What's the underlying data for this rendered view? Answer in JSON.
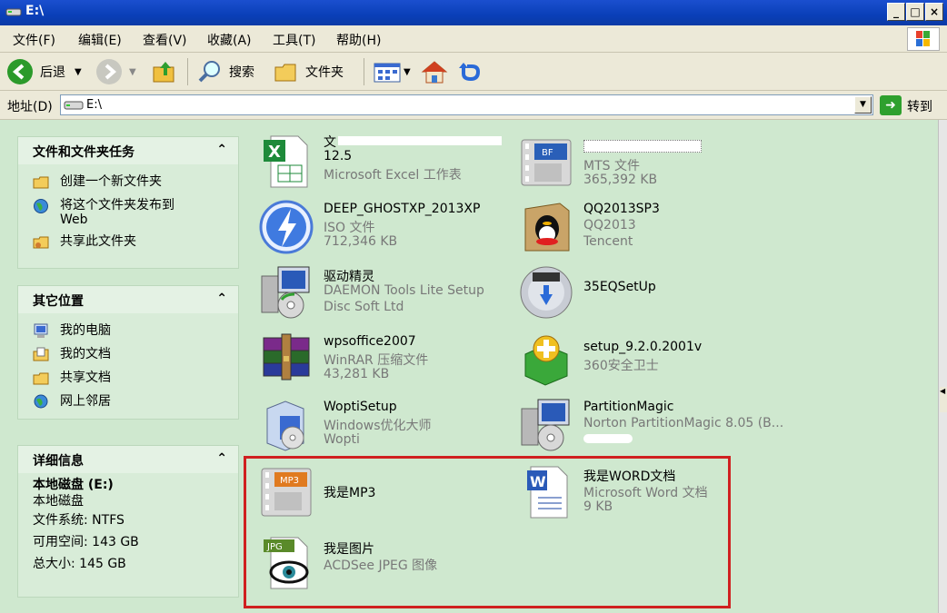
{
  "window": {
    "title": "E:\\"
  },
  "menu": [
    "文件(F)",
    "编辑(E)",
    "查看(V)",
    "收藏(A)",
    "工具(T)",
    "帮助(H)"
  ],
  "toolbar": {
    "back_label": "后退",
    "search_label": "搜索",
    "folders_label": "文件夹"
  },
  "address": {
    "label": "地址(D)",
    "value": "E:\\",
    "go_label": "转到"
  },
  "left_pane": {
    "tasks": {
      "title": "文件和文件夹任务",
      "items": [
        {
          "label": "创建一个新文件夹",
          "icon": "new-folder-icon"
        },
        {
          "label": "将这个文件夹发布到",
          "label2": "Web",
          "icon": "publish-web-icon"
        },
        {
          "label": "共享此文件夹",
          "icon": "share-folder-icon"
        }
      ]
    },
    "places": {
      "title": "其它位置",
      "items": [
        {
          "label": "我的电脑",
          "icon": "my-computer-icon"
        },
        {
          "label": "我的文档",
          "icon": "my-documents-icon"
        },
        {
          "label": "共享文档",
          "icon": "shared-documents-icon"
        },
        {
          "label": "网上邻居",
          "icon": "network-icon"
        }
      ]
    },
    "details": {
      "title": "详细信息",
      "name": "本地磁盘 (E:)",
      "type": "本地磁盘",
      "fs": "文件系统: NTFS",
      "free": "可用空间: 143 GB",
      "total": "总大小: 145 GB"
    }
  },
  "files": [
    {
      "name": "文",
      "name2": "12.5",
      "desc": "Microsoft Excel 工作表",
      "icon": "excel-icon"
    },
    {
      "name": "",
      "desc": "MTS 文件",
      "desc2": "365,392 KB",
      "icon": "video-file-icon"
    },
    {
      "name": "DEEP_GHOSTXP_2013XP",
      "desc": "ISO 文件",
      "desc2": "712,346 KB",
      "icon": "daemon-iso-icon"
    },
    {
      "name": "QQ2013SP3",
      "desc": "QQ2013",
      "desc2": "Tencent",
      "icon": "qq-icon"
    },
    {
      "name": "驱动精灵",
      "desc": "DAEMON Tools Lite Setup",
      "desc2": "Disc Soft Ltd",
      "icon": "setup-icon"
    },
    {
      "name": "35EQSetUp",
      "icon": "setup-disc-icon"
    },
    {
      "name": "wpsoffice2007",
      "desc": "WinRAR 压缩文件",
      "desc2": "43,281 KB",
      "icon": "winrar-icon"
    },
    {
      "name": "setup_9.2.0.2001v",
      "desc": "360安全卫士",
      "icon": "360-icon"
    },
    {
      "name": "WoptiSetup",
      "desc": "Windows优化大师",
      "desc2": "Wopti",
      "icon": "installer-icon"
    },
    {
      "name": "PartitionMagic",
      "desc": "Norton PartitionMagic 8.05 (B...",
      "icon": "setup-icon"
    },
    {
      "name": "我是MP3",
      "icon": "mp3-icon"
    },
    {
      "name": "我是WORD文档",
      "desc": "Microsoft Word 文档",
      "desc2": "9 KB",
      "icon": "word-icon"
    },
    {
      "name": "我是图片",
      "desc": "ACDSee JPEG 图像",
      "icon": "jpeg-icon"
    }
  ]
}
